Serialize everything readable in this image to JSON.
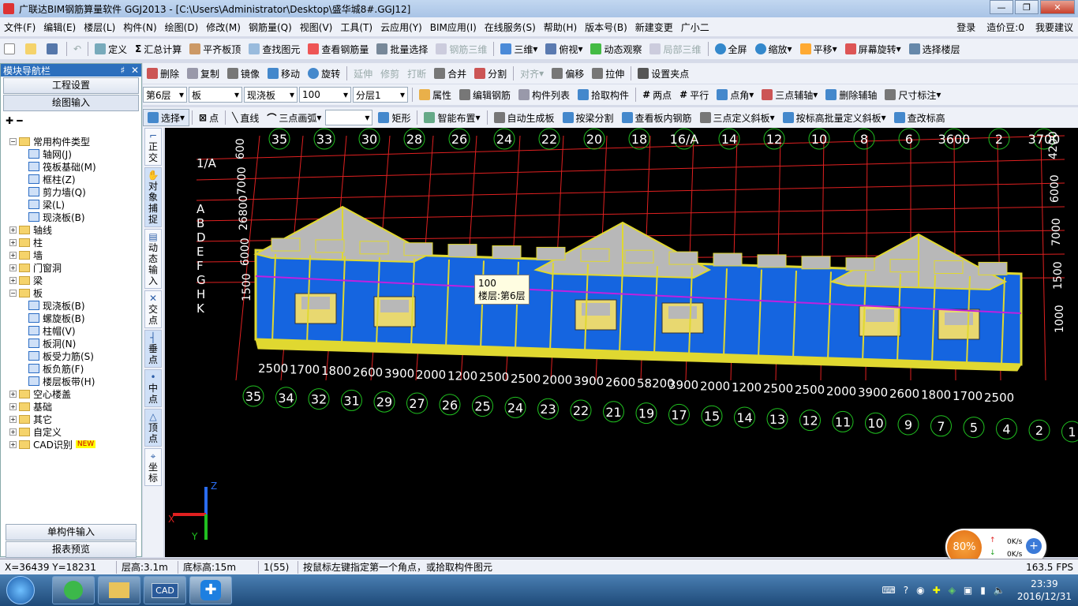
{
  "window": {
    "title": "广联达BIM钢筋算量软件 GGJ2013 - [C:\\Users\\Administrator\\Desktop\\盛华城8#.GGJ12]",
    "min": "—",
    "max": "❐",
    "close": "✕"
  },
  "menu": {
    "items": [
      "文件(F)",
      "编辑(E)",
      "楼层(L)",
      "构件(N)",
      "绘图(D)",
      "修改(M)",
      "钢筋量(Q)",
      "视图(V)",
      "工具(T)",
      "云应用(Y)",
      "BIM应用(I)",
      "在线服务(S)",
      "帮助(H)",
      "版本号(B)",
      "新建变更",
      "广小二"
    ],
    "login": "登录",
    "beans": "造价豆:0",
    "feedback": "我要建议"
  },
  "toolbar1": {
    "items": [
      "定义",
      "汇总计算",
      "平齐板顶",
      "查找图元",
      "查看钢筋量",
      "批量选择",
      "钢筋三维",
      "三维",
      "俯视",
      "动态观察",
      "局部三维",
      "全屏",
      "缩放",
      "平移",
      "屏幕旋转",
      "选择楼层"
    ]
  },
  "toolbar2": {
    "items": [
      "删除",
      "复制",
      "镜像",
      "移动",
      "旋转",
      "延伸",
      "修剪",
      "打断",
      "合并",
      "分割",
      "对齐",
      "偏移",
      "拉伸",
      "设置夹点"
    ]
  },
  "toolbar3": {
    "floor": "第6层",
    "type": "板",
    "subtype": "现浇板",
    "thickness": "100",
    "layer": "分层1",
    "items": [
      "属性",
      "编辑钢筋",
      "构件列表",
      "拾取构件",
      "两点",
      "平行",
      "点角",
      "三点辅轴",
      "删除辅轴",
      "尺寸标注"
    ]
  },
  "toolbar4": {
    "items": [
      "选择",
      "点",
      "直线",
      "三点画弧",
      "矩形",
      "智能布置",
      "自动生成板",
      "按梁分割",
      "查看板内钢筋",
      "三点定义斜板",
      "按标高批量定义斜板",
      "查改标高"
    ]
  },
  "nav": {
    "title": "模块导航栏",
    "pin": "♯",
    "close": "✕",
    "btn_setup": "工程设置",
    "btn_draw": "绘图输入",
    "btn_single": "单构件输入",
    "btn_report": "报表预览",
    "tree": [
      {
        "label": "常用构件类型",
        "level": 0,
        "expanded": true,
        "folder": true
      },
      {
        "label": "轴网(J)",
        "level": 1
      },
      {
        "label": "筏板基础(M)",
        "level": 1
      },
      {
        "label": "框柱(Z)",
        "level": 1
      },
      {
        "label": "剪力墙(Q)",
        "level": 1
      },
      {
        "label": "梁(L)",
        "level": 1
      },
      {
        "label": "现浇板(B)",
        "level": 1
      },
      {
        "label": "轴线",
        "level": 0,
        "folder": true
      },
      {
        "label": "柱",
        "level": 0,
        "folder": true
      },
      {
        "label": "墙",
        "level": 0,
        "folder": true
      },
      {
        "label": "门窗洞",
        "level": 0,
        "folder": true
      },
      {
        "label": "梁",
        "level": 0,
        "folder": true
      },
      {
        "label": "板",
        "level": 0,
        "expanded": true,
        "folder": true
      },
      {
        "label": "现浇板(B)",
        "level": 1
      },
      {
        "label": "螺旋板(B)",
        "level": 1
      },
      {
        "label": "柱帽(V)",
        "level": 1
      },
      {
        "label": "板洞(N)",
        "level": 1
      },
      {
        "label": "板受力筋(S)",
        "level": 1
      },
      {
        "label": "板负筋(F)",
        "level": 1
      },
      {
        "label": "楼层板带(H)",
        "level": 1
      },
      {
        "label": "空心楼盖",
        "level": 0,
        "folder": true
      },
      {
        "label": "基础",
        "level": 0,
        "folder": true
      },
      {
        "label": "其它",
        "level": 0,
        "folder": true
      },
      {
        "label": "自定义",
        "level": 0,
        "folder": true
      },
      {
        "label": "CAD识别",
        "level": 0,
        "folder": true,
        "badge": "NEW"
      }
    ]
  },
  "vtools": [
    "正交",
    "对象捕捉",
    "动态输入",
    "交点",
    "垂点",
    "中点",
    "顶点",
    "坐标"
  ],
  "canvas": {
    "top_axes": [
      "35",
      "33",
      "30",
      "28",
      "26",
      "24",
      "22",
      "20",
      "18",
      "16/A",
      "14",
      "12",
      "10",
      "8",
      "6",
      "3600",
      "2",
      "3700"
    ],
    "bottom_dims": [
      "2500",
      "1700",
      "1800",
      "2600",
      "3900",
      "2000",
      "1200",
      "2500",
      "2500",
      "2000",
      "3900",
      "2600",
      "58200",
      "3900",
      "2000",
      "1200",
      "2500",
      "2500",
      "2000",
      "3900",
      "2600",
      "1800",
      "1700",
      "2500"
    ],
    "bottom_axes": [
      "35",
      "34",
      "32",
      "31",
      "29",
      "27",
      "26",
      "25",
      "24",
      "23",
      "22",
      "21",
      "19",
      "17",
      "15",
      "14",
      "13",
      "12",
      "11",
      "10",
      "9",
      "7",
      "5",
      "4",
      "2",
      "1"
    ],
    "left_labels": [
      "1/A",
      "A",
      "B",
      "D",
      "E",
      "F",
      "G",
      "H",
      "K"
    ],
    "left_dims": [
      "600",
      "7000",
      "26800",
      "6000",
      "1500"
    ],
    "right_dims": [
      "4200",
      "6000",
      "7000",
      "1500",
      "1000"
    ],
    "tooltip_line1": "100",
    "tooltip_line2": "楼层:第6层",
    "axis_x": "X",
    "axis_y": "Y",
    "axis_z": "Z"
  },
  "widget": {
    "percent": "80%",
    "up": "0K/s",
    "down": "0K/s"
  },
  "status": {
    "coords": "X=36439 Y=18231",
    "floor_height": "层高:3.1m",
    "base_height": "底标高:15m",
    "count": "1(55)",
    "hint": "按鼠标左键指定第一个角点，或拾取构件图元",
    "fps": "163.5 FPS"
  },
  "taskbar": {
    "time": "23:39",
    "date": "2016/12/31",
    "cad_label": "CAD"
  },
  "colors": {
    "slab": "#1565e0",
    "beam": "#e0d830",
    "roof": "#b8b8b8",
    "grid": "#ff2020",
    "axis": "#20c020",
    "accent": "#2c6fbd"
  }
}
